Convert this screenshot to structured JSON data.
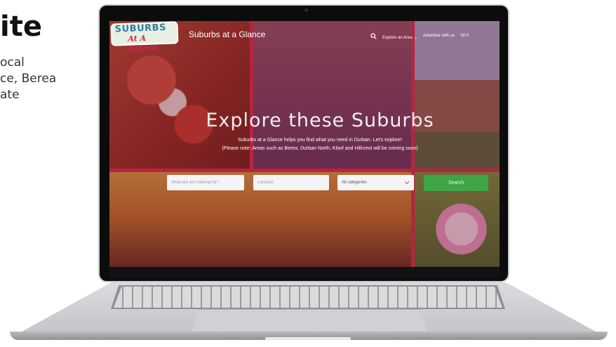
{
  "side": {
    "title": "ite",
    "lines": [
      "ocal",
      "ce, Berea",
      "ate"
    ]
  },
  "logo": {
    "line1": "SUBURBS",
    "line2": "At A Glance"
  },
  "header": {
    "site_title": "Suburbs at a Glance",
    "nav": {
      "explore": "Explore an Area",
      "advertise": "Advertise with us",
      "all": "All A"
    }
  },
  "hero": {
    "title": "Explore these Suburbs",
    "sub1": "Suburbs at a Glance helps you find what you need in Durban. Let's explore!",
    "sub2": "(Please note: Areas such as Berea, Durban North, Kloof and Hillcrest will be coming soon)"
  },
  "search": {
    "what_placeholder": "What are you looking for?",
    "location_placeholder": "Location",
    "category_value": "All categories",
    "button_label": "Search"
  },
  "colors": {
    "accent_green": "#3fa548",
    "divider_red": "#b8243e",
    "logo_blue": "#2e7ea6",
    "logo_red": "#d2234d"
  },
  "icons": [
    "search-icon",
    "chevron-down-icon"
  ]
}
